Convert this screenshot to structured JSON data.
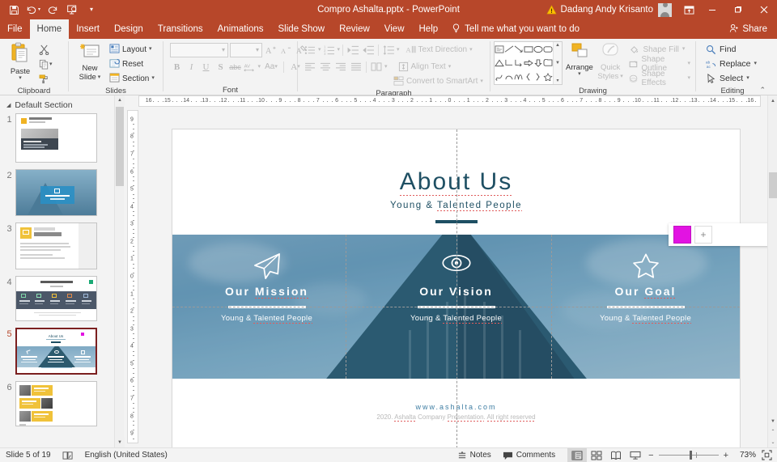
{
  "app": {
    "title": "Compro Ashalta.pptx  -  PowerPoint",
    "account_name": "Dadang Andy Krisanto"
  },
  "quick_access": [
    {
      "name": "save-icon",
      "glyph": "save"
    },
    {
      "name": "undo-icon",
      "glyph": "undo"
    },
    {
      "name": "redo-icon",
      "glyph": "redo"
    },
    {
      "name": "start-presentation-icon",
      "glyph": "present"
    },
    {
      "name": "customize-quick-access-toolbar-icon",
      "glyph": "chevron"
    }
  ],
  "window_controls": {
    "ribbon_display_options": "▣",
    "minimize": "—",
    "restore": "❐",
    "close": "✕"
  },
  "tabs": [
    {
      "label": "File",
      "active": false
    },
    {
      "label": "Home",
      "active": true
    },
    {
      "label": "Insert",
      "active": false
    },
    {
      "label": "Design",
      "active": false
    },
    {
      "label": "Transitions",
      "active": false
    },
    {
      "label": "Animations",
      "active": false
    },
    {
      "label": "Slide Show",
      "active": false
    },
    {
      "label": "Review",
      "active": false
    },
    {
      "label": "View",
      "active": false
    },
    {
      "label": "Help",
      "active": false
    }
  ],
  "tell_me": "Tell me what you want to do",
  "share_label": "Share",
  "ribbon": {
    "clipboard": {
      "label": "Clipboard",
      "paste": "Paste",
      "cut": "Cut",
      "copy": "Copy",
      "format_painter": "Format Painter"
    },
    "slides": {
      "label": "Slides",
      "new_slide": "New\nSlide",
      "new_slide_line1": "New",
      "new_slide_line2": "Slide",
      "layout": "Layout",
      "reset": "Reset",
      "section": "Section"
    },
    "font": {
      "label": "Font",
      "font_name": "",
      "font_size": "",
      "bold": "B",
      "italic": "I",
      "underline": "U",
      "strikethrough": "S",
      "text_shadow": "abc",
      "character_spacing": "AV",
      "change_case": "Aa",
      "font_color": "A",
      "increase_font": "A",
      "decrease_font": "A",
      "clear_formatting": "clear-formatting"
    },
    "paragraph": {
      "label": "Paragraph",
      "text_direction": "Text Direction",
      "align_text": "Align Text",
      "convert_to_smartart": "Convert to SmartArt"
    },
    "drawing": {
      "label": "Drawing",
      "arrange": "Arrange",
      "quick_styles_line1": "Quick",
      "quick_styles_line2": "Styles",
      "shape_fill": "Shape Fill",
      "shape_outline": "Shape Outline",
      "shape_effects": "Shape Effects"
    },
    "editing": {
      "label": "Editing",
      "find": "Find",
      "replace": "Replace",
      "select": "Select"
    }
  },
  "thumbnails": {
    "section_label": "Default Section",
    "slides": [
      {
        "number": "1",
        "selected": false
      },
      {
        "number": "2",
        "selected": false
      },
      {
        "number": "3",
        "selected": false
      },
      {
        "number": "4",
        "selected": false
      },
      {
        "number": "5",
        "selected": true
      },
      {
        "number": "6",
        "selected": false
      }
    ]
  },
  "ruler": {
    "horizontal_ticks": [
      "16",
      "15",
      "14",
      "13",
      "12",
      "11",
      "10",
      "9",
      "8",
      "7",
      "6",
      "5",
      "4",
      "3",
      "2",
      "1",
      "0",
      "1",
      "2",
      "3",
      "4",
      "5",
      "6",
      "7",
      "8",
      "9",
      "10",
      "11",
      "12",
      "13",
      "14",
      "15",
      "16"
    ],
    "vertical_ticks": [
      "9",
      "8",
      "7",
      "6",
      "5",
      "4",
      "3",
      "2",
      "1",
      "0",
      "1",
      "2",
      "3",
      "4",
      "5",
      "6",
      "7",
      "8",
      "9"
    ]
  },
  "slide": {
    "title": "About Us",
    "subtitle": "Young & Talented People",
    "columns": [
      {
        "icon": "paper-plane-icon",
        "title": "Our Mission",
        "desc": "Young & Talented People"
      },
      {
        "icon": "eye-icon",
        "title": "Our Vision",
        "desc": "Young & Talented People"
      },
      {
        "icon": "star-icon",
        "title": "Our Goal",
        "desc": "Young & Talented People"
      }
    ],
    "website": "www.ashalta.com",
    "copyright": "2020. Ashalta Company Presentation. All right reserved"
  },
  "floating_panel": {
    "swatch_color": "#e213e2",
    "add_label": "+"
  },
  "status_bar": {
    "slide_counter": "Slide 5 of 19",
    "language": "English (United States)",
    "notes": "Notes",
    "comments": "Comments",
    "zoom_percent": "73%",
    "views": [
      {
        "name": "normal-view-button",
        "active": true
      },
      {
        "name": "slide-sorter-view-button",
        "active": false
      },
      {
        "name": "reading-view-button",
        "active": false
      },
      {
        "name": "slide-show-button",
        "active": false
      }
    ]
  },
  "colors": {
    "ribbon_accent": "#b7472a",
    "slide_teal": "#1e4f63",
    "swatch_magenta": "#e213e2"
  }
}
